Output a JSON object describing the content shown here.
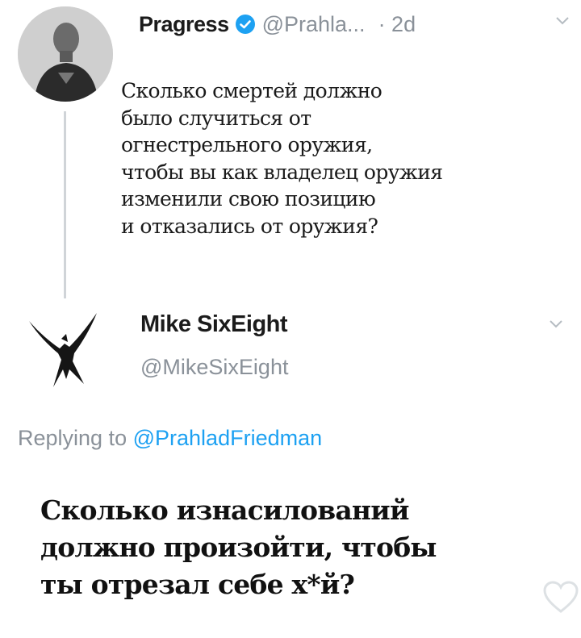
{
  "tweet": {
    "author_name": "Pragress",
    "handle": "@Prahla...",
    "time": "· 2d",
    "lines": [
      "Сколько смертей должно",
      "было случиться от",
      "огнестрельного оружия,",
      "чтобы вы как владелец оружия",
      "изменили свою позицию",
      "и отказались от оружия?"
    ]
  },
  "reply": {
    "author_name": "Mike SixEight",
    "handle": "@MikeSixEight",
    "replying_prefix": "Replying to",
    "replying_mention": "@PrahladFriedman",
    "lines": [
      "Сколько изнасилований",
      "должно произойти, чтобы",
      "ты отрезал себе х*й?"
    ]
  },
  "colors": {
    "verified": "#1da1f2",
    "muted_text": "#8a9199",
    "mention": "#1da1f2",
    "thread_line": "#d0d4d8"
  },
  "icons": [
    "verified-badge-icon",
    "chevron-down-icon",
    "heart-icon"
  ]
}
